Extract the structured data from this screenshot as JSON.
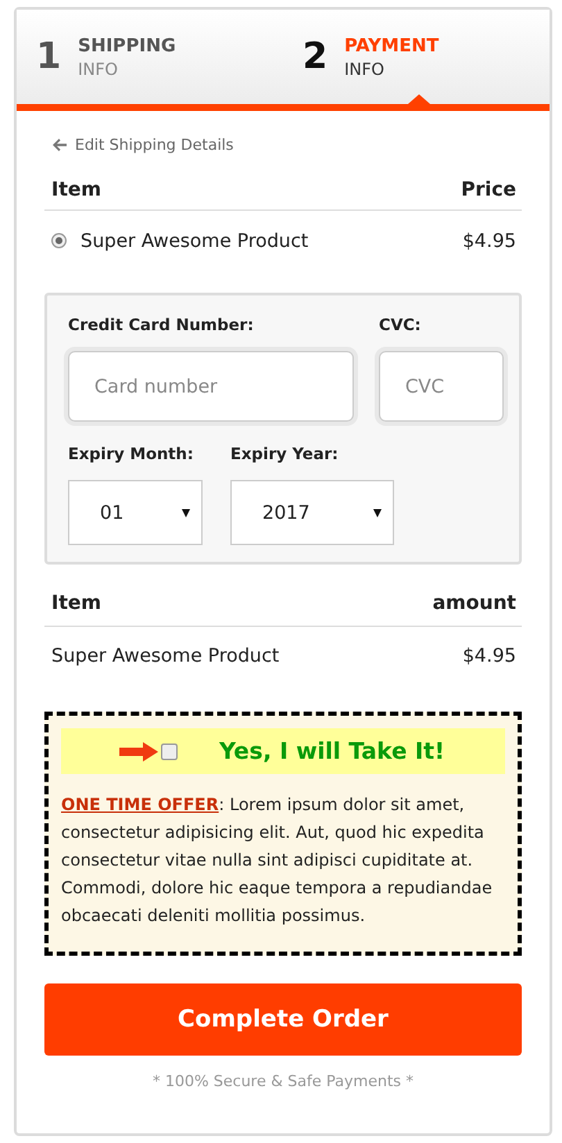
{
  "steps": [
    {
      "number": "1",
      "title": "SHIPPING",
      "subtitle": "INFO",
      "selected": false
    },
    {
      "number": "2",
      "title": "PAYMENT",
      "subtitle": "INFO",
      "selected": true
    }
  ],
  "back_link": "Edit Shipping Details",
  "product_table": {
    "columns": [
      "Item",
      "Price"
    ],
    "rows": [
      {
        "name": "Super Awesome Product",
        "price": "$4.95",
        "checked": true
      }
    ]
  },
  "card_form": {
    "card_label": "Credit Card Number:",
    "card_placeholder": "Card number",
    "cvc_label": "CVC:",
    "cvc_placeholder": "CVC",
    "month_label": "Expiry Month:",
    "month_value": "01",
    "year_label": "Expiry Year:",
    "year_value": "2017"
  },
  "summary_table": {
    "columns": [
      "Item",
      "amount"
    ],
    "rows": [
      {
        "name": "Super Awesome Product",
        "amount": "$4.95"
      }
    ]
  },
  "offer": {
    "checkbox_label": "Yes, I will Take It!",
    "checked": false,
    "offer_label": "ONE TIME OFFER",
    "text": ": Lorem ipsum dolor sit amet, consectetur adipisicing elit. Aut, quod hic expedita consectetur vitae nulla sint adipisci cupiditate at. Commodi, dolore hic eaque tempora a repudiandae obcaecati deleniti mollitia possimus."
  },
  "submit_button": "Complete Order",
  "footer_note": "* 100% Secure & Safe Payments *"
}
